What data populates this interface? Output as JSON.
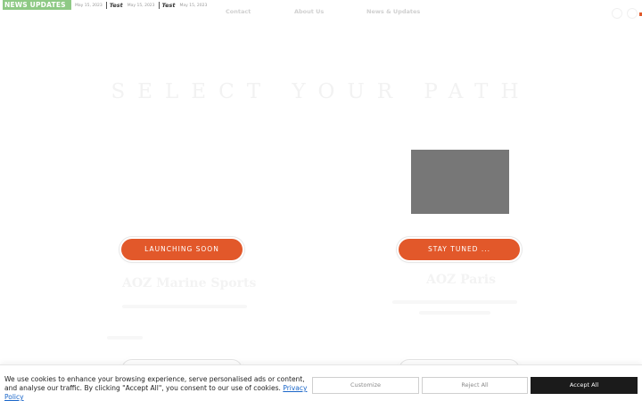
{
  "ticker": {
    "badge": "NEWS UPDATES",
    "items": [
      {
        "date": "May 15, 2023",
        "title": "Test"
      },
      {
        "date": "May 15, 2023",
        "title": "Test"
      },
      {
        "date": "May 15, 2023",
        "title": ""
      }
    ]
  },
  "nav": {
    "contact": "Contact",
    "about": "About Us",
    "news": "News & Updates"
  },
  "main": {
    "heading": "SELECT YOUR PATH",
    "cards": [
      {
        "button": "LAUNCHING SOON",
        "title": "AOZ Marine Sports"
      },
      {
        "button": "STAY TUNED ...",
        "title": "AOZ Paris"
      }
    ]
  },
  "cookie": {
    "text": "We use cookies to enhance your browsing experience, serve personalised ads or content, and analyse our traffic. By clicking \"Accept All\", you consent to our use of cookies.",
    "link": "Privacy Policy",
    "customize": "Customize",
    "reject": "Reject All",
    "accept": "Accept All"
  },
  "colors": {
    "accent": "#e2582a",
    "badge": "#8ec985",
    "link": "#1a66c9"
  }
}
